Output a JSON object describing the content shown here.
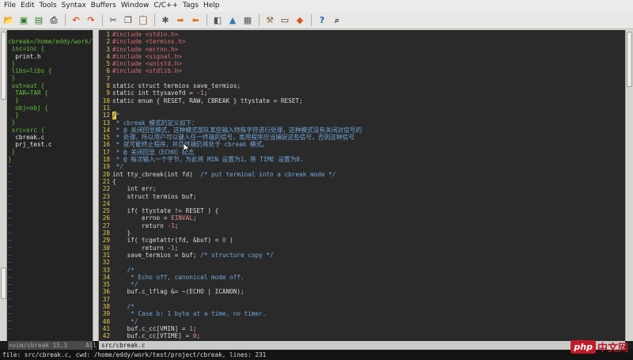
{
  "menubar": {
    "items": [
      {
        "label": "File",
        "ul": "F",
        "rest": "ile"
      },
      {
        "label": "Edit",
        "ul": "E",
        "rest": "dit"
      },
      {
        "label": "Tools",
        "ul": "T",
        "rest": "ools"
      },
      {
        "label": "Syntax",
        "ul": "S",
        "rest": "yntax"
      },
      {
        "label": "Buffers",
        "ul": "B",
        "rest": "uffers"
      },
      {
        "label": "Window",
        "ul": "W",
        "rest": "indow"
      },
      {
        "label": "C/C++",
        "ul": "C",
        "rest": "/C++"
      },
      {
        "label": "Tags",
        "ul": "",
        "rest": "Tags"
      },
      {
        "label": "Help",
        "ul": "H",
        "rest": "elp"
      }
    ]
  },
  "toolbar": {
    "buttons": [
      {
        "name": "open-icon",
        "glyph": "📂",
        "color": "#d9a12b"
      },
      {
        "name": "save-icon",
        "glyph": "▣",
        "color": "#2f7a2f"
      },
      {
        "name": "save-all-icon",
        "glyph": "▤",
        "color": "#2f7a2f"
      },
      {
        "name": "print-icon",
        "glyph": "⎙",
        "color": "#555555"
      },
      {
        "name": "sep"
      },
      {
        "name": "undo-icon",
        "glyph": "↶",
        "color": "#d9531e"
      },
      {
        "name": "redo-icon",
        "glyph": "↷",
        "color": "#d9531e"
      },
      {
        "name": "sep"
      },
      {
        "name": "cut-icon",
        "glyph": "✂",
        "color": "#444444"
      },
      {
        "name": "copy-icon",
        "glyph": "❐",
        "color": "#444444"
      },
      {
        "name": "paste-icon",
        "glyph": "📋",
        "color": "#8a6d3b"
      },
      {
        "name": "sep"
      },
      {
        "name": "find-replace-icon",
        "glyph": "✱",
        "color": "#555555"
      },
      {
        "name": "find-next-icon",
        "glyph": "➡",
        "color": "#e07a22"
      },
      {
        "name": "find-prev-icon",
        "glyph": "⬅",
        "color": "#e07a22"
      },
      {
        "name": "sep"
      },
      {
        "name": "load-session-icon",
        "glyph": "◧",
        "color": "#555555"
      },
      {
        "name": "save-session-icon",
        "glyph": "▲",
        "color": "#2b7bb9"
      },
      {
        "name": "run-script-icon",
        "glyph": "▦",
        "color": "#555555"
      },
      {
        "name": "sep"
      },
      {
        "name": "make-icon",
        "glyph": "⚒",
        "color": "#8a6d3b"
      },
      {
        "name": "shell-icon",
        "glyph": "▭",
        "color": "#444444"
      },
      {
        "name": "tag-jump-icon",
        "glyph": "◆",
        "color": "#d9531e"
      },
      {
        "name": "sep"
      },
      {
        "name": "help-icon",
        "glyph": "?",
        "color": "#1d5fb8"
      },
      {
        "name": "search-help-icon",
        "glyph": "⌕",
        "color": "#333333"
      }
    ]
  },
  "tree": {
    "lines": [
      {
        "text": "cbreak=/home/eddy/work/t",
        "cls": "t-green"
      },
      {
        "text": " inc=inc {",
        "cls": "t-green"
      },
      {
        "text": "  print.h",
        "cls": "t-white"
      },
      {
        "text": " }",
        "cls": "t-green"
      },
      {
        "text": " libs=libs {",
        "cls": "t-green"
      },
      {
        "text": " }",
        "cls": "t-green"
      },
      {
        "text": " out=out {",
        "cls": "t-green"
      },
      {
        "text": "  TAR=TAR {",
        "cls": "t-green"
      },
      {
        "text": "  }",
        "cls": "t-green"
      },
      {
        "text": "  obj=obj {",
        "cls": "t-green"
      },
      {
        "text": "  }",
        "cls": "t-green"
      },
      {
        "text": " }",
        "cls": "t-green"
      },
      {
        "text": " src=src {",
        "cls": "t-green"
      },
      {
        "text": "  cbreak.c",
        "cls": "t-white"
      },
      {
        "text": "  prj_test.c",
        "cls": "t-white"
      },
      {
        "text": " }",
        "cls": "t-green"
      },
      {
        "text": "}",
        "cls": "t-green"
      }
    ],
    "tilde": "~",
    "tilde_count": 23
  },
  "editor": {
    "lines": [
      {
        "n": "1",
        "segs": [
          [
            "k-pre",
            "#include <stdio.h>"
          ]
        ]
      },
      {
        "n": "2",
        "segs": [
          [
            "k-pre",
            "#include <termios.h>"
          ]
        ]
      },
      {
        "n": "3",
        "segs": [
          [
            "k-pre",
            "#include <errno.h>"
          ]
        ]
      },
      {
        "n": "4",
        "segs": [
          [
            "k-pre",
            "#include <signal.h>"
          ]
        ]
      },
      {
        "n": "5",
        "segs": [
          [
            "k-pre",
            "#include <unistd.h>"
          ]
        ]
      },
      {
        "n": "6",
        "segs": [
          [
            "k-pre",
            "#include <stdlib.h>"
          ]
        ]
      },
      {
        "n": "7",
        "segs": []
      },
      {
        "n": "8",
        "segs": [
          [
            "code",
            "static struct termios save_termios;"
          ]
        ]
      },
      {
        "n": "9",
        "segs": [
          [
            "code",
            "static int ttysavefd = "
          ],
          [
            "k-num",
            "-1"
          ],
          [
            "code",
            ";"
          ]
        ]
      },
      {
        "n": "10",
        "segs": [
          [
            "code",
            "static enum { RESET, RAW, CBREAK } ttystate = RESET;"
          ]
        ]
      },
      {
        "n": "11",
        "segs": []
      },
      {
        "n": "12",
        "segs": [
          [
            "cursor",
            "/"
          ],
          [
            "k-cmt",
            "*"
          ]
        ]
      },
      {
        "n": "13",
        "segs": [
          [
            "k-cmt",
            " * cbreak 模式的定义如下："
          ]
        ]
      },
      {
        "n": "14",
        "segs": [
          [
            "k-cmt",
            " * @ 关闭回显模式，这种模式部队某些输入特殊字符进行处理，这种模式没有关闭对信号的"
          ]
        ]
      },
      {
        "n": "15",
        "segs": [
          [
            "k-cmt",
            " * 处理，所以用户可以键入任一终端的信号，类用程序应当捕捉这些信号，否则这种信号"
          ]
        ]
      },
      {
        "n": "16",
        "segs": [
          [
            "k-cmt",
            " * 就可能终止程序，并且终端仍将处于 cbreak 模式。"
          ]
        ]
      },
      {
        "n": "17",
        "segs": [
          [
            "k-cmt",
            " * @ 关闭回显（ECHO）标志"
          ]
        ]
      },
      {
        "n": "18",
        "segs": [
          [
            "k-cmt",
            " * @ 每次输入一个字节，为此将 MIN 设置为1，将 TIME 设置为0."
          ]
        ]
      },
      {
        "n": "19",
        "segs": [
          [
            "k-cmt",
            " */"
          ]
        ]
      },
      {
        "n": "20",
        "segs": [
          [
            "code",
            "int tty_cbreak(int fd)  "
          ],
          [
            "k-cmt",
            "/* put terminal into a cbreak mode */"
          ]
        ]
      },
      {
        "n": "21",
        "segs": [
          [
            "code",
            "{"
          ]
        ]
      },
      {
        "n": "22",
        "segs": [
          [
            "code",
            "    int err;"
          ]
        ]
      },
      {
        "n": "23",
        "segs": [
          [
            "code",
            "    struct termios buf;"
          ]
        ]
      },
      {
        "n": "24",
        "segs": []
      },
      {
        "n": "25",
        "segs": [
          [
            "code",
            "    if( ttystate != RESET ) {"
          ]
        ]
      },
      {
        "n": "26",
        "segs": [
          [
            "code",
            "        errno = "
          ],
          [
            "k-num",
            "EINVAL"
          ],
          [
            "code",
            ";"
          ]
        ]
      },
      {
        "n": "27",
        "segs": [
          [
            "code",
            "        return "
          ],
          [
            "k-num",
            "-1"
          ],
          [
            "code",
            ";"
          ]
        ]
      },
      {
        "n": "28",
        "segs": [
          [
            "code",
            "    }"
          ]
        ]
      },
      {
        "n": "29",
        "segs": [
          [
            "code",
            "    if( tcgetattr(fd, &buf) < "
          ],
          [
            "k-num",
            "0"
          ],
          [
            "code",
            " )"
          ]
        ]
      },
      {
        "n": "30",
        "segs": [
          [
            "code",
            "        return "
          ],
          [
            "k-num",
            "-1"
          ],
          [
            "code",
            ";"
          ]
        ]
      },
      {
        "n": "31",
        "segs": [
          [
            "code",
            "    save_termios = buf; "
          ],
          [
            "k-cmt",
            "/* structure copy */"
          ]
        ]
      },
      {
        "n": "32",
        "segs": []
      },
      {
        "n": "33",
        "segs": [
          [
            "k-cmt",
            "    /*"
          ]
        ]
      },
      {
        "n": "34",
        "segs": [
          [
            "k-cmt",
            "     * Echo off, canonical mode off."
          ]
        ]
      },
      {
        "n": "35",
        "segs": [
          [
            "k-cmt",
            "     */"
          ]
        ]
      },
      {
        "n": "36",
        "segs": [
          [
            "code",
            "    buf.c_lflag &= ~(ECHO | ICANON);"
          ]
        ]
      },
      {
        "n": "37",
        "segs": []
      },
      {
        "n": "38",
        "segs": [
          [
            "k-cmt",
            "    /*"
          ]
        ]
      },
      {
        "n": "39",
        "segs": [
          [
            "k-cmt",
            "     * Case b: 1 byte at a time, no timer."
          ]
        ]
      },
      {
        "n": "40",
        "segs": [
          [
            "k-cmt",
            "     */"
          ]
        ]
      },
      {
        "n": "41",
        "segs": [
          [
            "code",
            "    buf.c_cc[VMIN] = "
          ],
          [
            "k-num",
            "1"
          ],
          [
            "code",
            ";"
          ]
        ]
      },
      {
        "n": "42",
        "segs": [
          [
            "code",
            "    buf.c_cc[VTIME] = "
          ],
          [
            "k-num",
            "0"
          ],
          [
            "code",
            ";"
          ]
        ]
      }
    ]
  },
  "status": {
    "left": "<vim/cbreak 15,3     All",
    "right": "src/cbreak.c"
  },
  "cmdline": "file: src/cbreak.c, cwd: /home/eddy/work/test/project/cbreak, lines: 231",
  "watermark": {
    "logo": "php",
    "site": "中文网"
  }
}
